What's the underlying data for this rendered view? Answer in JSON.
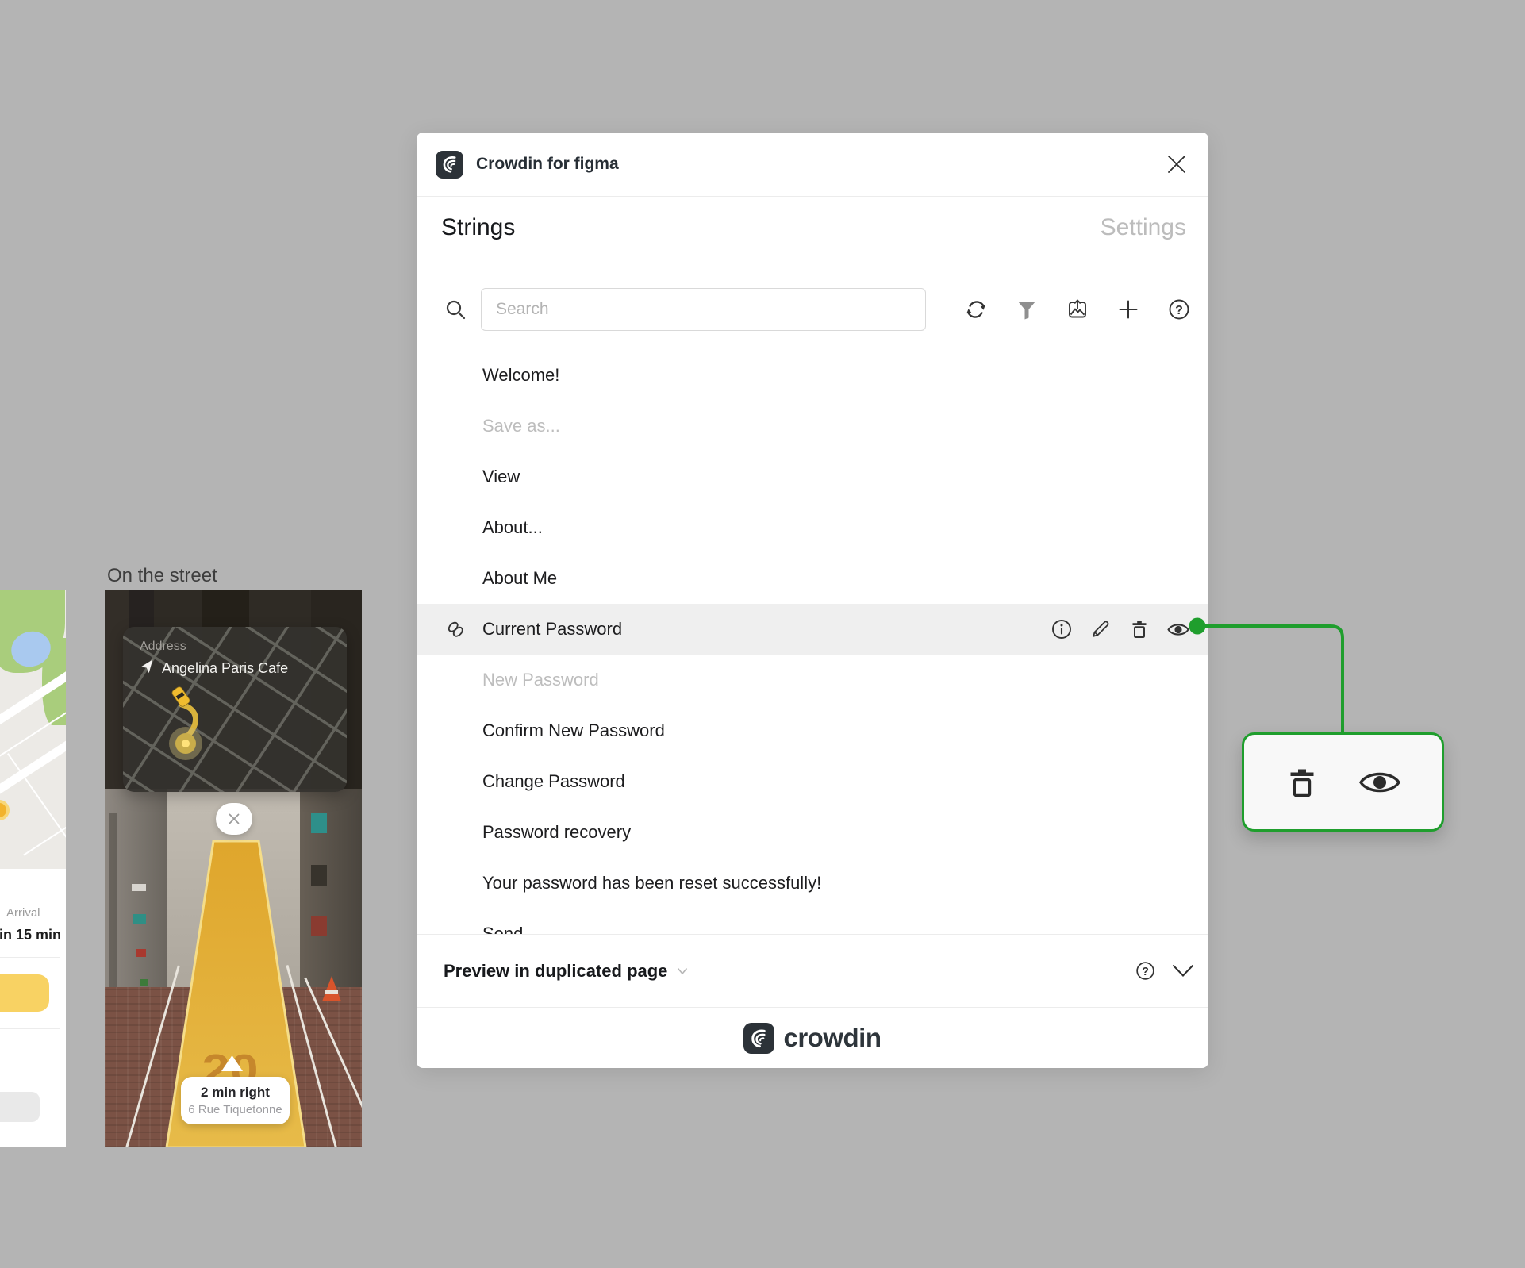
{
  "canvas": {
    "on_the_street_label": "On the street"
  },
  "left_phone": {
    "arrival_label": "Arrival",
    "arrival_time": "in 15 min"
  },
  "main_phone": {
    "address_label": "Address",
    "address_value": "Angelina Paris Cafe",
    "direction_title": "2 min right",
    "direction_subtitle": "6 Rue Tiquetonne",
    "ar_distance": "20"
  },
  "modal": {
    "title": "Crowdin for figma",
    "tabs": [
      {
        "label": "Strings",
        "active": true
      },
      {
        "label": "Settings",
        "active": false
      }
    ],
    "search_placeholder": "Search",
    "toolbar_icons": [
      "sync",
      "filter",
      "export-image",
      "add",
      "help"
    ],
    "strings": [
      {
        "label": "Welcome!"
      },
      {
        "label": "Save as...",
        "muted": true
      },
      {
        "label": "View"
      },
      {
        "label": "About..."
      },
      {
        "label": "About Me"
      },
      {
        "label": "Current Password",
        "selected": true
      },
      {
        "label": "New Password",
        "muted": true
      },
      {
        "label": "Confirm New Password"
      },
      {
        "label": "Change Password"
      },
      {
        "label": "Password recovery"
      },
      {
        "label": "Your password has been reset successfully!"
      },
      {
        "label": "Send",
        "clipped": true
      }
    ],
    "preview": {
      "label": "Preview in duplicated page"
    },
    "footer_brand": "crowdin",
    "colors": {
      "accent_green": "#1f9e2d",
      "highlight_row": "#efefef",
      "brand_dark": "#2c3238"
    }
  },
  "popover": {
    "icons": [
      "delete",
      "visibility"
    ]
  }
}
